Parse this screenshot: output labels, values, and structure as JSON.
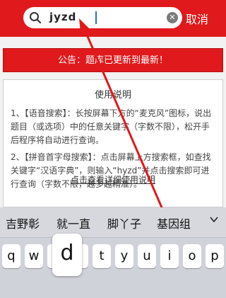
{
  "search": {
    "value": "jyzd",
    "cancel_label": "取消"
  },
  "notice": {
    "text": "公告：题库已更新到最新！"
  },
  "help": {
    "title": "使用说明",
    "paragraph1": "1、【语音搜索】：长按屏幕下方的“麦克风”图标，说出题目（或选项）中的任意关键字（字数不限），松开手后程序将自动进行查询。",
    "paragraph2": "2、【拼音首字母搜索】：点击屏幕上方搜索框，如查找关键字“汉语字典”，则输入“hyzd”并点击搜索即可进行查询（字数不限，越多越精准）。",
    "link": "点击查看详细使用说明"
  },
  "keyboard": {
    "candidates": [
      "吉野彰",
      "就一直",
      "脚丫子",
      "基因组"
    ],
    "row1": [
      "q",
      "w",
      "e",
      "r",
      "t",
      "y",
      "u",
      "i",
      "o",
      "p"
    ],
    "pressed_key": "d"
  },
  "colors": {
    "accent": "#e0191c",
    "background": "#f2f2f2"
  }
}
